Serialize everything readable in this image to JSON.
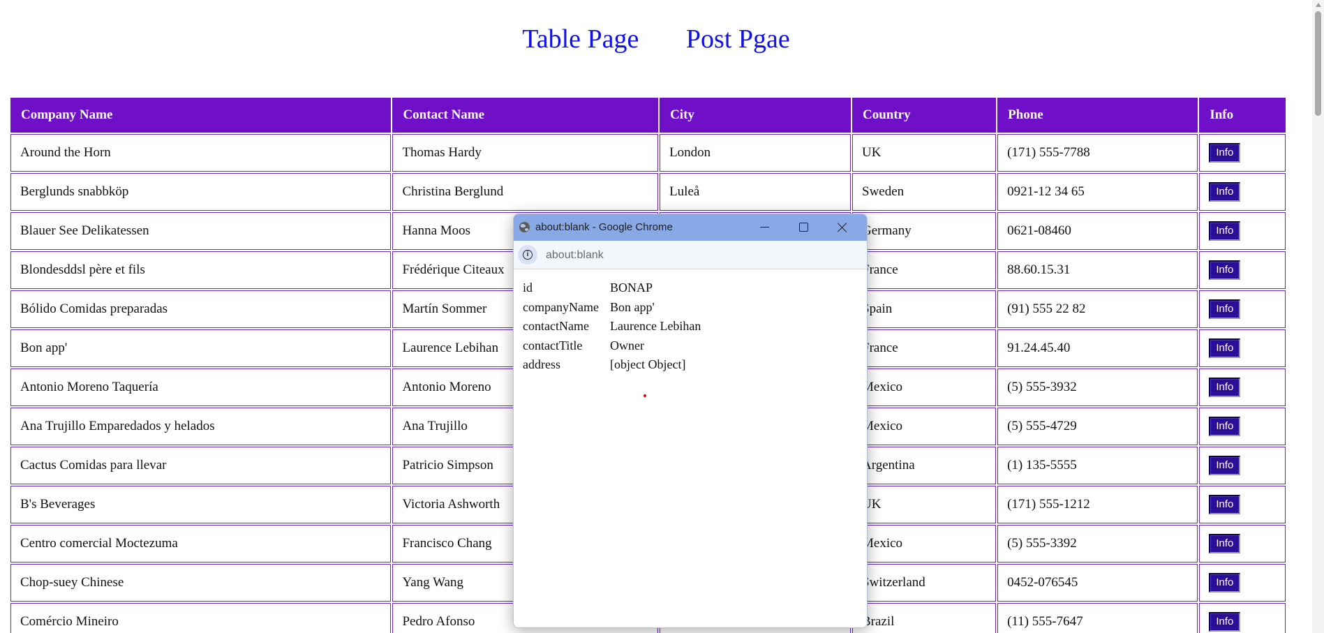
{
  "nav": {
    "links": [
      {
        "label": "Table Page"
      },
      {
        "label": "Post Pgae"
      }
    ]
  },
  "table": {
    "headers": [
      "Company Name",
      "Contact Name",
      "City",
      "Country",
      "Phone",
      "Info"
    ],
    "rows": [
      [
        "Around the Horn",
        "Thomas Hardy",
        "London",
        "UK",
        "(171) 555-7788",
        "Info"
      ],
      [
        "Berglunds snabbköp",
        "Christina Berglund",
        "Luleå",
        "Sweden",
        "0921-12 34 65",
        "Info"
      ],
      [
        "Blauer See Delikatessen",
        "Hanna Moos",
        "",
        "Germany",
        "0621-08460",
        "Info"
      ],
      [
        "Blondesddsl père et fils",
        "Frédérique Citeaux",
        "",
        "France",
        "88.60.15.31",
        "Info"
      ],
      [
        "Bólido Comidas preparadas",
        "Martín Sommer",
        "",
        "Spain",
        "(91) 555 22 82",
        "Info"
      ],
      [
        "Bon app'",
        "Laurence Lebihan",
        "",
        "France",
        "91.24.45.40",
        "Info"
      ],
      [
        "Antonio Moreno Taquería",
        "Antonio Moreno",
        "",
        "Mexico",
        "(5) 555-3932",
        "Info"
      ],
      [
        "Ana Trujillo Emparedados y helados",
        "Ana Trujillo",
        "",
        "Mexico",
        "(5) 555-4729",
        "Info"
      ],
      [
        "Cactus Comidas para llevar",
        "Patricio Simpson",
        "",
        "Argentina",
        "(1) 135-5555",
        "Info"
      ],
      [
        "B's Beverages",
        "Victoria Ashworth",
        "",
        "UK",
        "(171) 555-1212",
        "Info"
      ],
      [
        "Centro comercial Moctezuma",
        "Francisco Chang",
        "",
        "Mexico",
        "(5) 555-3392",
        "Info"
      ],
      [
        "Chop-suey Chinese",
        "Yang Wang",
        "",
        "Switzerland",
        "0452-076545",
        "Info"
      ],
      [
        "Comércio Mineiro",
        "Pedro Afonso",
        "",
        "Brazil",
        "(11) 555-7647",
        "Info"
      ]
    ]
  },
  "popup": {
    "title": "about:blank - Google Chrome",
    "url": "about:blank",
    "properties": [
      {
        "key": "id",
        "value": "BONAP"
      },
      {
        "key": "companyName",
        "value": "Bon app'"
      },
      {
        "key": "contactName",
        "value": "Laurence Lebihan"
      },
      {
        "key": "contactTitle",
        "value": "Owner"
      },
      {
        "key": "address",
        "value": "[object Object]"
      }
    ]
  },
  "colors": {
    "header_bg": "#6f0fc8",
    "link": "#1010e8",
    "button_bg": "#2b0d96",
    "popup_titlebar": "#89a9e6"
  },
  "icons": [
    "globe-icon",
    "minimize-icon",
    "maximize-icon",
    "close-icon",
    "site-info-icon"
  ]
}
